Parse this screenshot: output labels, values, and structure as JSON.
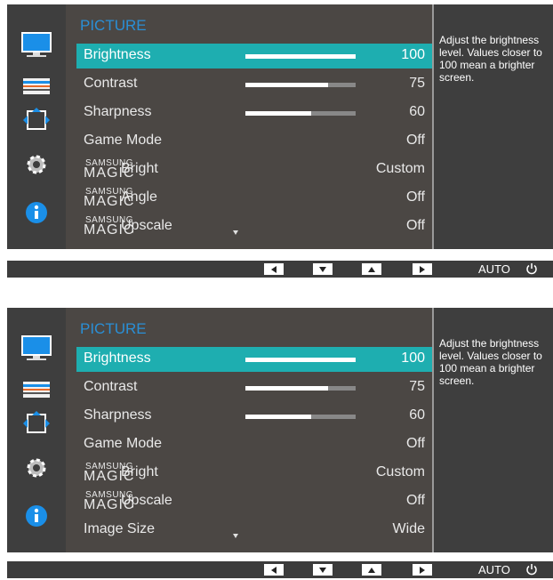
{
  "colors": {
    "accent": "#1eaeb0",
    "title": "#2a8fd6",
    "panel": "#4b4744",
    "sidebar": "#3e3e3e"
  },
  "sidebar_icons": [
    "picture-icon",
    "color-icon",
    "size-position-icon",
    "setup-icon",
    "information-icon"
  ],
  "panel_a": {
    "title": "PICTURE",
    "brightness": {
      "label": "Brightness",
      "value": "100",
      "level": 1.0
    },
    "contrast": {
      "label": "Contrast",
      "value": "75",
      "level": 0.75
    },
    "sharpness": {
      "label": "Sharpness",
      "value": "60",
      "level": 0.6
    },
    "game_mode": {
      "label": "Game Mode",
      "value": "Off"
    },
    "magic_bright": {
      "samsung": "SAMSUNG",
      "magic": "MAGIC",
      "label": "Bright",
      "value": "Custom"
    },
    "magic_angle": {
      "samsung": "SAMSUNG",
      "magic": "MAGIC",
      "label": "Angle",
      "value": "Off"
    },
    "magic_upscale": {
      "samsung": "SAMSUNG",
      "magic": "MAGIC",
      "label": "Upscale",
      "value": "Off"
    },
    "help": "Adjust the brightness level. Values closer to 100 mean a brighter screen."
  },
  "panel_b": {
    "title": "PICTURE",
    "brightness": {
      "label": "Brightness",
      "value": "100",
      "level": 1.0
    },
    "contrast": {
      "label": "Contrast",
      "value": "75",
      "level": 0.75
    },
    "sharpness": {
      "label": "Sharpness",
      "value": "60",
      "level": 0.6
    },
    "game_mode": {
      "label": "Game Mode",
      "value": "Off"
    },
    "magic_bright": {
      "samsung": "SAMSUNG",
      "magic": "MAGIC",
      "label": "Bright",
      "value": "Custom"
    },
    "magic_upscale": {
      "samsung": "SAMSUNG",
      "magic": "MAGIC",
      "label": "Upscale",
      "value": "Off"
    },
    "image_size": {
      "label": "Image Size",
      "value": "Wide"
    },
    "help": "Adjust the brightness level. Values closer to 100 mean a brighter screen."
  },
  "button_bar": {
    "auto_label": "AUTO",
    "buttons": [
      "left-arrow-icon",
      "down-arrow-icon",
      "up-arrow-icon",
      "right-arrow-icon",
      "power-icon"
    ]
  }
}
